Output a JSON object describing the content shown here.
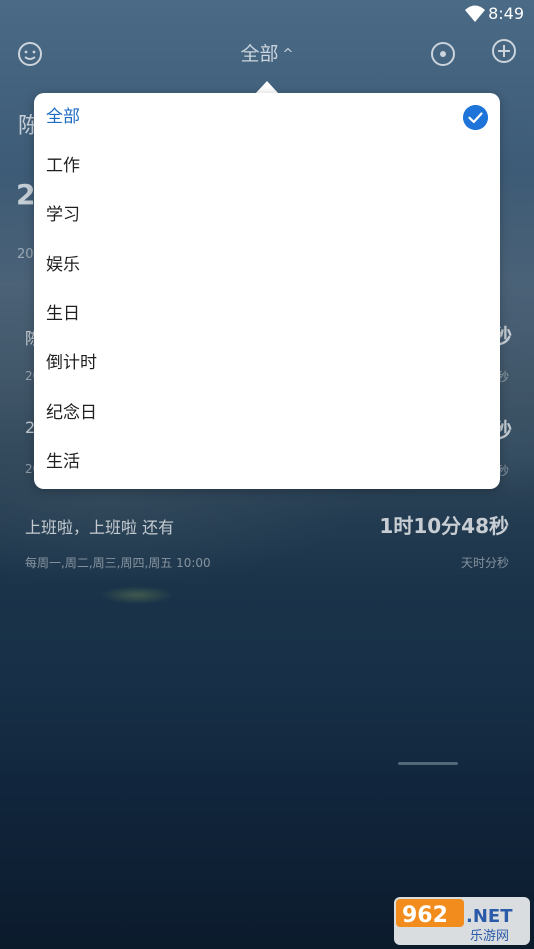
{
  "status_bar": {
    "time": "8:49"
  },
  "header": {
    "title": "全部",
    "caret": "^"
  },
  "dropdown": {
    "items": [
      {
        "label": "全部",
        "selected": true
      },
      {
        "label": "工作",
        "selected": false
      },
      {
        "label": "学习",
        "selected": false
      },
      {
        "label": "娱乐",
        "selected": false
      },
      {
        "label": "生日",
        "selected": false
      },
      {
        "label": "倒计时",
        "selected": false
      },
      {
        "label": "纪念日",
        "selected": false
      },
      {
        "label": "生活",
        "selected": false
      }
    ],
    "selected_color": "#1d6cc4"
  },
  "background_rows": {
    "partial_1": "陈",
    "partial_2": "2",
    "partial_3": "20",
    "partial_4": "陈",
    "partial_5": "20",
    "partial_6": "2",
    "partial_7": "20",
    "value_1": "秒",
    "unit_1": "秒",
    "value_2": "秒",
    "unit_2": "秒"
  },
  "event_row": {
    "title": "上班啦，上班啦 还有",
    "countdown": "1时10分48秒",
    "schedule": "每周一,周二,周三,周四,周五 10:00",
    "unit": "天时分秒"
  },
  "watermark": {
    "text_top": "962.NET",
    "text_bottom": "乐游网"
  }
}
